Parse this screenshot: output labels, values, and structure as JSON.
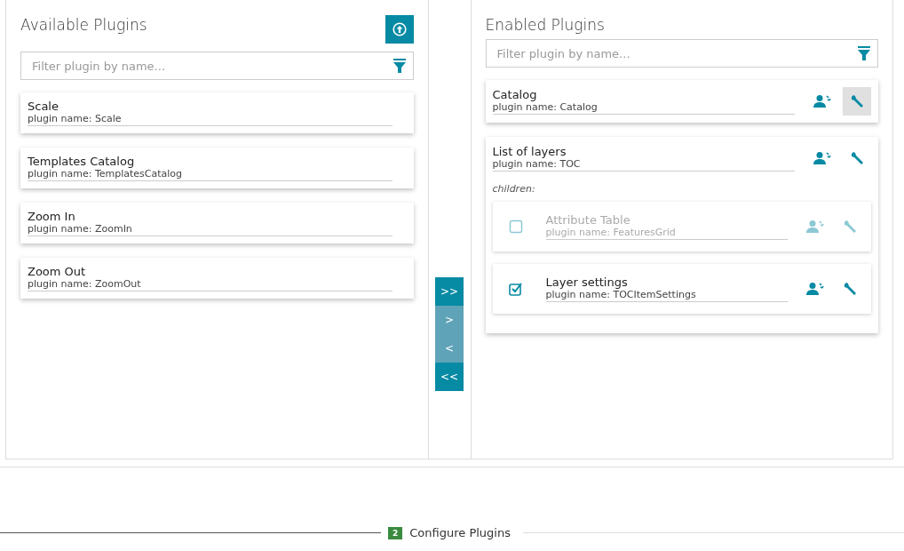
{
  "available": {
    "title": "Available Plugins",
    "filter": {
      "placeholder": "Filter plugin by name..."
    },
    "plugins": [
      {
        "title": "Scale",
        "name": "plugin name: Scale"
      },
      {
        "title": "Templates Catalog",
        "name": "plugin name: TemplatesCatalog"
      },
      {
        "title": "Zoom In",
        "name": "plugin name: ZoomIn"
      },
      {
        "title": "Zoom Out",
        "name": "plugin name: ZoomOut"
      }
    ]
  },
  "transfer_buttons": [
    {
      "label": ">>",
      "disabled": false
    },
    {
      "label": ">",
      "disabled": true
    },
    {
      "label": "<",
      "disabled": true
    },
    {
      "label": "<<",
      "disabled": false
    }
  ],
  "enabled": {
    "title": "Enabled Plugins",
    "filter": {
      "placeholder": "Filter plugin by name..."
    },
    "plugins": [
      {
        "title": "Catalog",
        "name": "plugin name: Catalog",
        "configure_selected": true
      },
      {
        "title": "List of layers",
        "name": "plugin name: TOC",
        "configure_selected": false,
        "children_label": "children:",
        "children": [
          {
            "title": "Attribute Table",
            "name": "plugin name: FeaturesGrid",
            "checked": false
          },
          {
            "title": "Layer settings",
            "name": "plugin name: TOCItemSettings",
            "checked": true
          }
        ]
      }
    ]
  },
  "step": {
    "number": "2",
    "label": "Configure Plugins"
  }
}
